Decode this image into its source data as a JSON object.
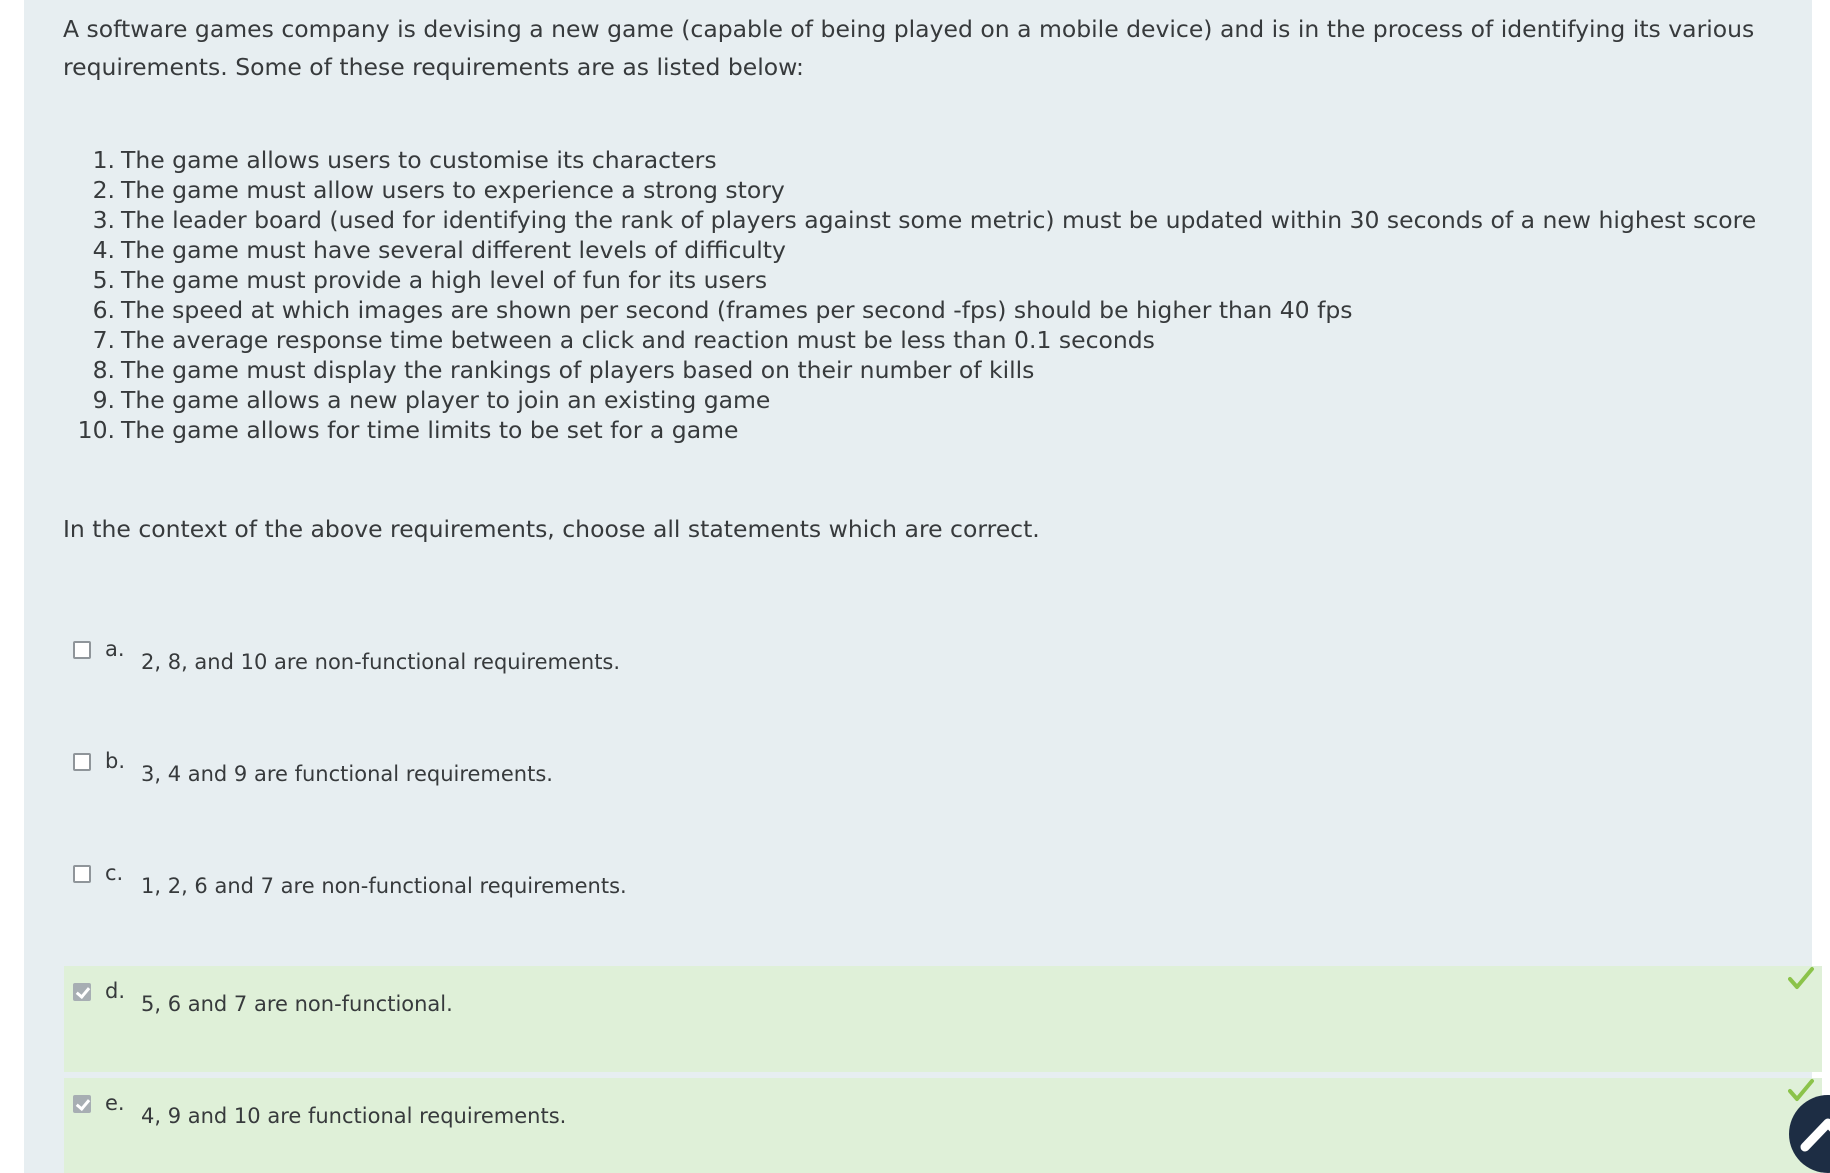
{
  "question": {
    "intro": "A software games company is devising a new game (capable of being played on a mobile device) and is in the process of identifying its various requirements.  Some of these requirements are as listed below:",
    "requirements": [
      {
        "num": "1.",
        "text": "The game allows users to customise its characters"
      },
      {
        "num": "2.",
        "text": "The game must allow users to experience a strong story"
      },
      {
        "num": "3.",
        "text": "The leader board (used for identifying the rank of players against some metric) must be updated within 30 seconds of a new highest score"
      },
      {
        "num": "4.",
        "text": "The game must have several different levels of difficulty"
      },
      {
        "num": "5.",
        "text": "The game must provide a high level of fun for its users"
      },
      {
        "num": "6.",
        "text": "The speed at which images are shown per second (frames per second -fps) should be higher than 40 fps"
      },
      {
        "num": "7.",
        "text": "The average response time between a click and reaction must be less than 0.1 seconds"
      },
      {
        "num": "8.",
        "text": "The game must display the rankings of players based on their number of kills"
      },
      {
        "num": "9.",
        "text": "The game allows a new player to join an existing game"
      },
      {
        "num": "10.",
        "text": "The game allows for time limits to be set for a game"
      }
    ],
    "instruction": "In the context of the above requirements, choose all statements which are correct."
  },
  "options": [
    {
      "letter": "a.",
      "text": "2, 8, and 10 are non-functional requirements.",
      "checked": false,
      "correct": false
    },
    {
      "letter": "b.",
      "text": "3, 4 and 9 are functional requirements.",
      "checked": false,
      "correct": false
    },
    {
      "letter": "c.",
      "text": "1, 2, 6 and 7 are non-functional requirements.",
      "checked": false,
      "correct": false
    },
    {
      "letter": "d.",
      "text": "5, 6 and 7 are non-functional.",
      "checked": true,
      "correct": true
    },
    {
      "letter": "e.",
      "text": "4, 9 and 10 are functional requirements.",
      "checked": true,
      "correct": true
    }
  ],
  "colors": {
    "panel_bg": "#e7eef1",
    "correct_bg": "#dff0d8",
    "tick": "#8bc34a",
    "scroll_button": "#1d2d44"
  },
  "icons": {
    "correct": "checkmark-icon",
    "scroll_top": "chevron-up-icon"
  }
}
